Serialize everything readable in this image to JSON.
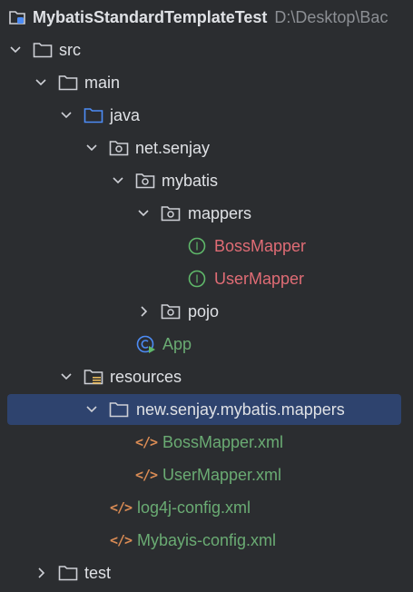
{
  "project": {
    "name": "MybatisStandardTemplateTest",
    "path": "D:\\Desktop\\Bac"
  },
  "tree": {
    "src": "src",
    "main": "main",
    "java": "java",
    "package": "net.senjay",
    "mybatis": "mybatis",
    "mappers": "mappers",
    "boss_mapper": "BossMapper",
    "user_mapper": "UserMapper",
    "pojo": "pojo",
    "app": "App",
    "resources": "resources",
    "res_package": "new.senjay.mybatis.mappers",
    "boss_mapper_xml": "BossMapper.xml",
    "user_mapper_xml": "UserMapper.xml",
    "log4j_config": "log4j-config.xml",
    "mybatis_config": "Mybayis-config.xml",
    "test": "test"
  },
  "icons": {
    "interface_badge": "I",
    "xml_glyph": "</>"
  },
  "colors": {
    "background": "#2b2d30",
    "selection": "#2e436e",
    "text": "#dfe1e5",
    "muted": "#8c8f94",
    "interface_name": "#e06c75",
    "interface_icon": "#5fb86a",
    "resource_file": "#6aab73",
    "java_folder": "#4d8cf5",
    "xml_icon": "#d98b54"
  }
}
